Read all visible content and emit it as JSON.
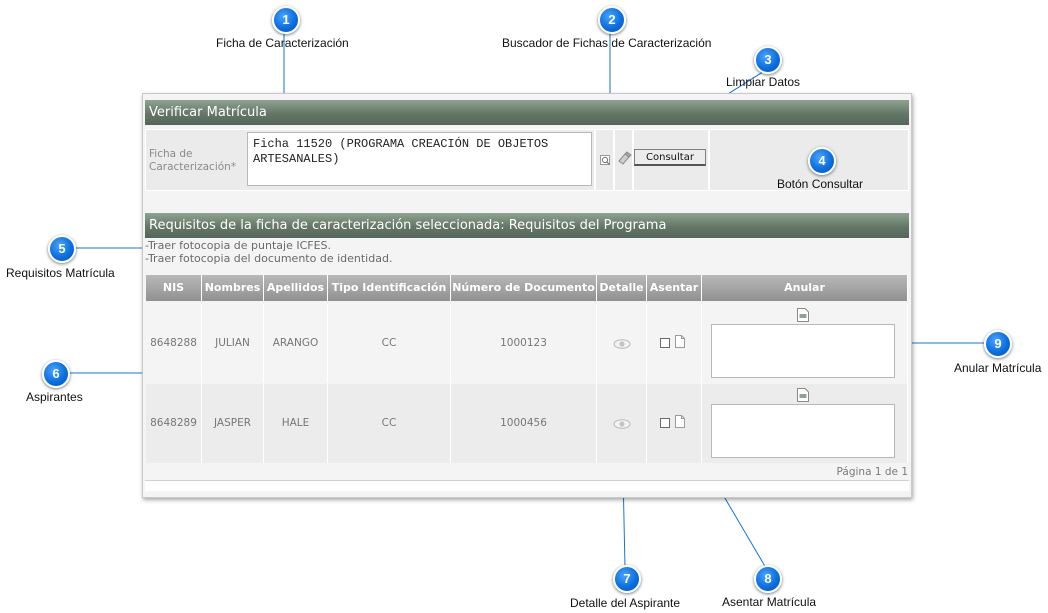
{
  "callouts": [
    {
      "num": "1",
      "label": "Ficha de Caracterización"
    },
    {
      "num": "2",
      "label": "Buscador de Fichas de Caracterización"
    },
    {
      "num": "3",
      "label": "Limpiar Datos"
    },
    {
      "num": "4",
      "label": "Botón Consultar"
    },
    {
      "num": "5",
      "label": "Requisitos Matrícula"
    },
    {
      "num": "6",
      "label": "Aspirantes"
    },
    {
      "num": "7",
      "label": "Detalle del Aspirante"
    },
    {
      "num": "8",
      "label": "Asentar Matrícula"
    },
    {
      "num": "9",
      "label": "Anular Matrícula"
    }
  ],
  "panel": {
    "title": "Verificar Matrícula",
    "field_label_line1": "Ficha de",
    "field_label_line2": "Caracterización*",
    "field_value": "Ficha 11520 (PROGRAMA CREACIÓN DE OBJETOS ARTESANALES)",
    "consultar_label": "Consultar"
  },
  "requisitos": {
    "title": "Requisitos de la ficha de caracterización seleccionada: Requisitos del Programa",
    "items": [
      "-Traer fotocopia de puntaje ICFES.",
      "-Traer fotocopia del documento de identidad."
    ]
  },
  "table": {
    "headers": [
      "NIS",
      "Nombres",
      "Apellidos",
      "Tipo Identificación",
      "Número de Documento",
      "Detalle",
      "Asentar",
      "Anular"
    ],
    "rows": [
      {
        "nis": "8648288",
        "nombres": "JULIAN",
        "apellidos": "ARANGO",
        "tipo": "CC",
        "documento": "1000123"
      },
      {
        "nis": "8648289",
        "nombres": "JASPER",
        "apellidos": "HALE",
        "tipo": "CC",
        "documento": "1000456"
      }
    ],
    "pager": "Página 1 de 1"
  },
  "icons": {
    "search": "magnifier-icon",
    "clear": "eraser-icon",
    "detail": "eye-icon",
    "asentar": "document-icon",
    "anular": "document-attach-icon"
  },
  "colors": {
    "header": "#647766",
    "badge": "#0a6fe0",
    "table_header": "#a1a1a1"
  }
}
